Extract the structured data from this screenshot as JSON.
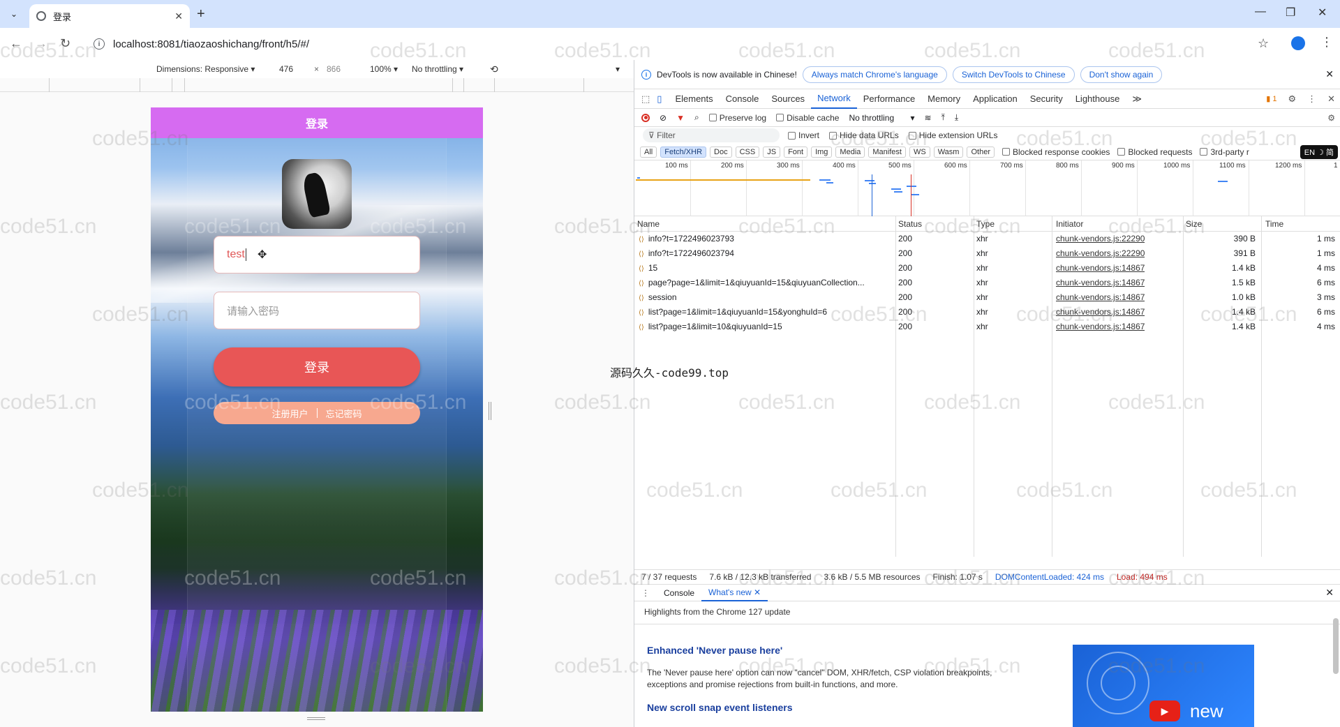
{
  "browser": {
    "tab_title": "登录",
    "url": "localhost:8081/tiaozaoshichang/front/h5/#/"
  },
  "device_toolbar": {
    "dimensions": "Dimensions: Responsive ▾",
    "width": "476",
    "times": "×",
    "height": "866",
    "zoom": "100% ▾",
    "throttle": "No throttling ▾"
  },
  "page": {
    "header_title": "登录",
    "username_value": "test",
    "password_placeholder": "请输入密码",
    "login_button": "登录",
    "register_link": "注册用户",
    "forgot_link": "忘记密码"
  },
  "devtools": {
    "info_message": "DevTools is now available in Chinese!",
    "info_btn_1": "Always match Chrome's language",
    "info_btn_2": "Switch DevTools to Chinese",
    "info_btn_3": "Don't show again",
    "tabs": [
      "Elements",
      "Console",
      "Sources",
      "Network",
      "Performance",
      "Memory",
      "Application",
      "Security",
      "Lighthouse"
    ],
    "tabs_more": "≫",
    "issues_badge": "1",
    "toolbar": {
      "preserve_log": "Preserve log",
      "disable_cache": "Disable cache",
      "throttle": "No throttling"
    },
    "filter": {
      "placeholder": "Filter",
      "invert": "Invert",
      "hide_data_urls": "Hide data URLs",
      "hide_extension_urls": "Hide extension URLs"
    },
    "types": [
      "All",
      "Fetch/XHR",
      "Doc",
      "CSS",
      "JS",
      "Font",
      "Img",
      "Media",
      "Manifest",
      "WS",
      "Wasm",
      "Other"
    ],
    "blocked_cookies": "Blocked response cookies",
    "blocked_requests": "Blocked requests",
    "third_party": "3rd-party r",
    "ime_badge": "EN ☽ 简",
    "timeline_labels": [
      "100 ms",
      "200 ms",
      "300 ms",
      "400 ms",
      "500 ms",
      "600 ms",
      "700 ms",
      "800 ms",
      "900 ms",
      "1000 ms",
      "1100 ms",
      "1200 ms",
      "1"
    ],
    "columns": {
      "name": "Name",
      "status": "Status",
      "type": "Type",
      "initiator": "Initiator",
      "size": "Size",
      "time": "Time"
    },
    "requests": [
      {
        "name": "info?t=1722496023793",
        "status": "200",
        "type": "xhr",
        "initiator": "chunk-vendors.js:22290",
        "size": "390 B",
        "time": "1 ms"
      },
      {
        "name": "info?t=1722496023794",
        "status": "200",
        "type": "xhr",
        "initiator": "chunk-vendors.js:22290",
        "size": "391 B",
        "time": "1 ms"
      },
      {
        "name": "15",
        "status": "200",
        "type": "xhr",
        "initiator": "chunk-vendors.js:14867",
        "size": "1.4 kB",
        "time": "4 ms"
      },
      {
        "name": "page?page=1&limit=1&qiuyuanId=15&qiuyuanCollection...",
        "status": "200",
        "type": "xhr",
        "initiator": "chunk-vendors.js:14867",
        "size": "1.5 kB",
        "time": "6 ms"
      },
      {
        "name": "session",
        "status": "200",
        "type": "xhr",
        "initiator": "chunk-vendors.js:14867",
        "size": "1.0 kB",
        "time": "3 ms"
      },
      {
        "name": "list?page=1&limit=1&qiuyuanId=15&yonghuId=6",
        "status": "200",
        "type": "xhr",
        "initiator": "chunk-vendors.js:14867",
        "size": "1.4 kB",
        "time": "6 ms"
      },
      {
        "name": "list?page=1&limit=10&qiuyuanId=15",
        "status": "200",
        "type": "xhr",
        "initiator": "chunk-vendors.js:14867",
        "size": "1.4 kB",
        "time": "4 ms"
      }
    ],
    "summary": {
      "requests": "7 / 37 requests",
      "transferred": "7.6 kB / 12.3 kB transferred",
      "resources": "3.6 kB / 5.5 MB resources",
      "finish": "Finish: 1.07 s",
      "dcl": "DOMContentLoaded: 424 ms",
      "load": "Load: 494 ms"
    },
    "drawer": {
      "tab_console": "Console",
      "tab_whatsnew": "What's new",
      "highlights": "Highlights from the Chrome 127 update",
      "h1": "Enhanced 'Never pause here'",
      "p1": "The 'Never pause here' option can now \"cancel\" DOM, XHR/fetch, CSP violation breakpoints, exceptions and promise rejections from built-in functions, and more.",
      "h2": "New scroll snap event listeners",
      "img_text": "new"
    }
  },
  "overlay_text": "源码久久-code99.top",
  "watermark": "code51.cn"
}
